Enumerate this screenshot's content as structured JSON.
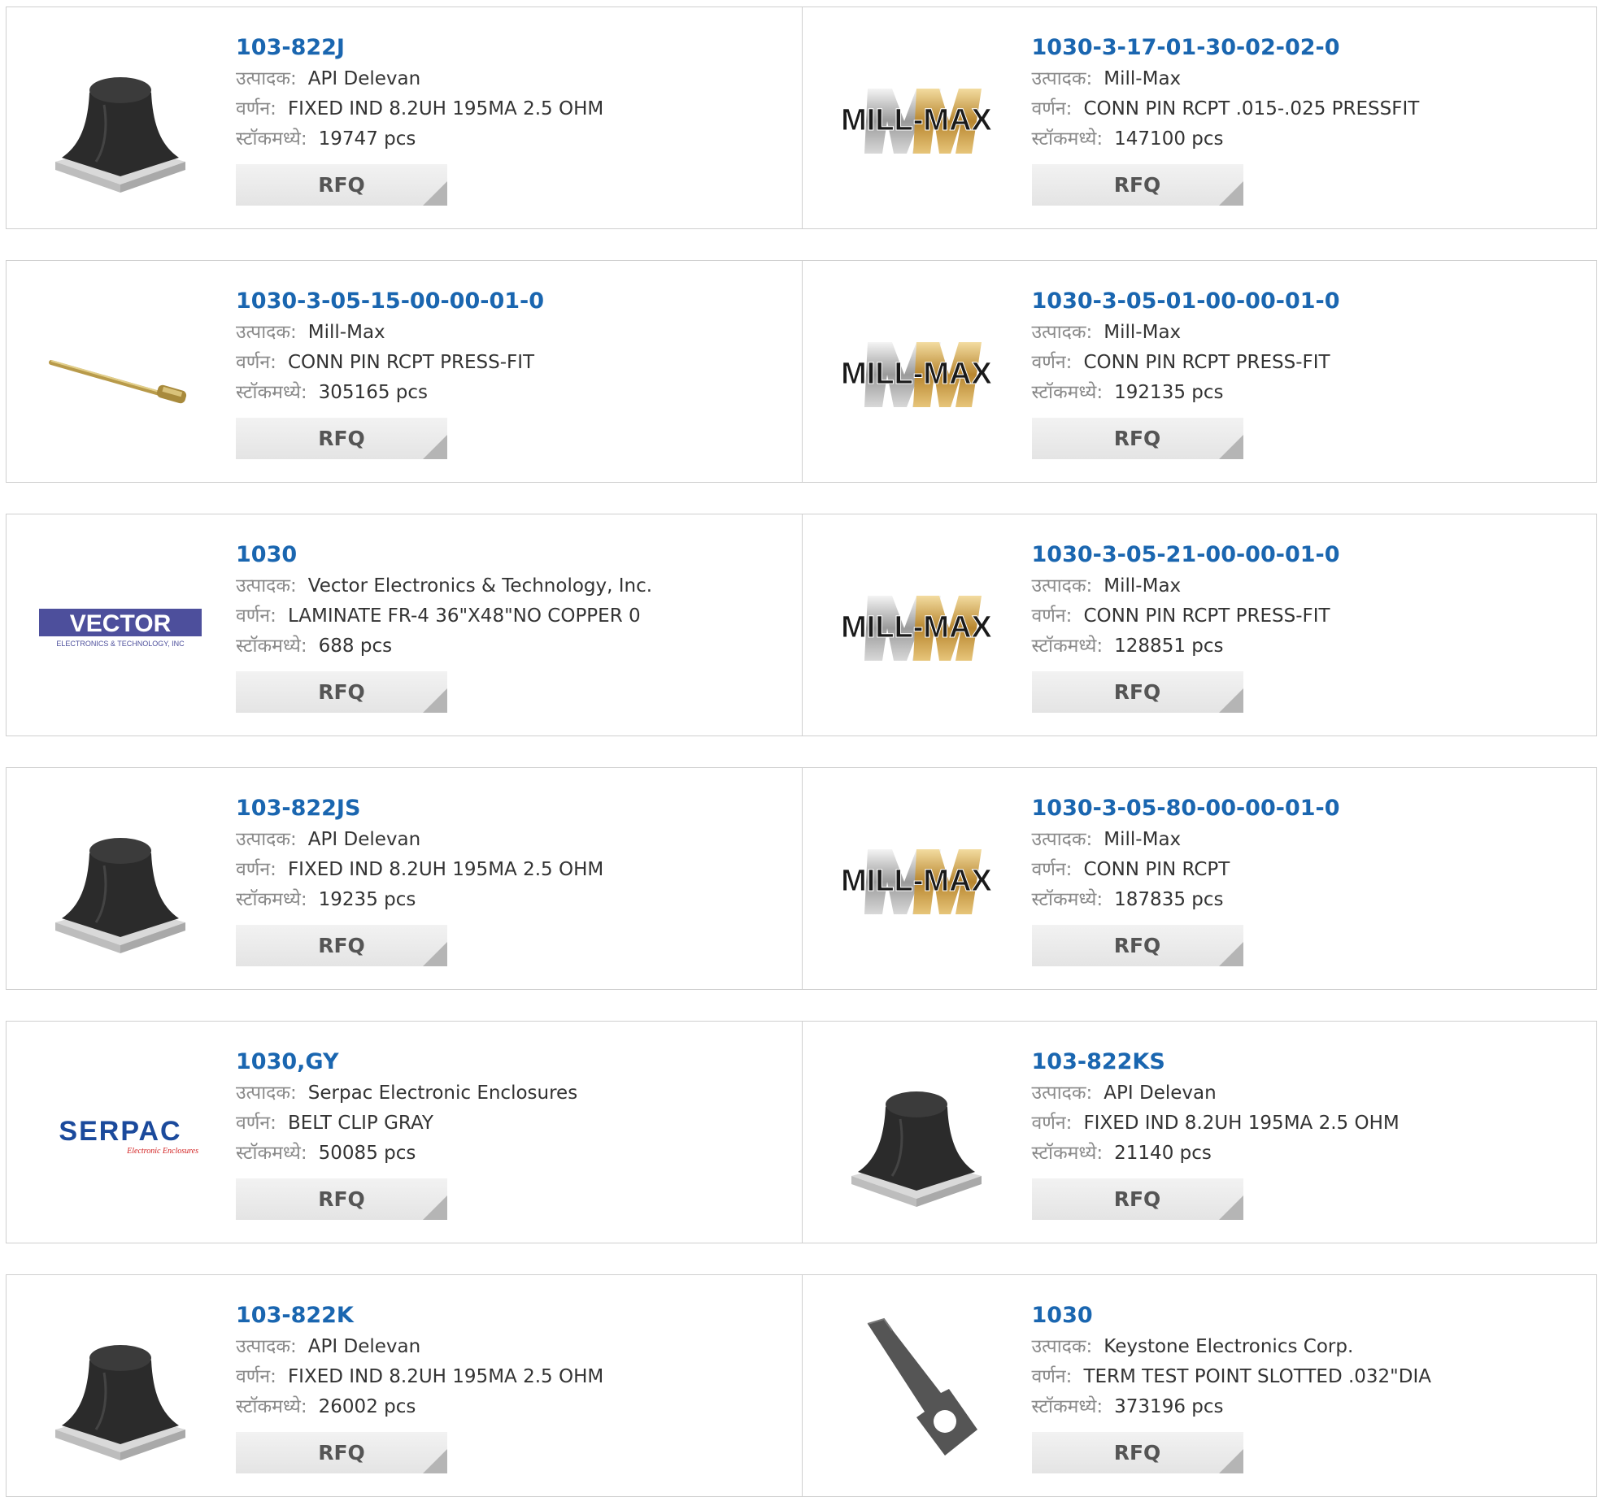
{
  "labels": {
    "manufacturer": "उत्पादक:",
    "description": "वर्णन:",
    "stock": "स्टॉकमध्ये:",
    "rfq": "RFQ"
  },
  "products": [
    {
      "part": "103-822J",
      "manufacturer": "API Delevan",
      "description": "FIXED IND 8.2UH 195MA 2.5 OHM",
      "stock": "19747 pcs",
      "image": "inductor-image"
    },
    {
      "part": "1030-3-17-01-30-02-02-0",
      "manufacturer": "Mill-Max",
      "description": "CONN PIN RCPT .015-.025 PRESSFIT",
      "stock": "147100 pcs",
      "image": "mill-max-logo"
    },
    {
      "part": "1030-3-05-15-00-00-01-0",
      "manufacturer": "Mill-Max",
      "description": "CONN PIN RCPT PRESS-FIT",
      "stock": "305165 pcs",
      "image": "pin-image"
    },
    {
      "part": "1030-3-05-01-00-00-01-0",
      "manufacturer": "Mill-Max",
      "description": "CONN PIN RCPT PRESS-FIT",
      "stock": "192135 pcs",
      "image": "mill-max-logo"
    },
    {
      "part": "1030",
      "manufacturer": "Vector Electronics & Technology, Inc.",
      "description": "LAMINATE FR-4 36\"X48\"NO COPPER 0",
      "stock": "688 pcs",
      "image": "vector-logo"
    },
    {
      "part": "1030-3-05-21-00-00-01-0",
      "manufacturer": "Mill-Max",
      "description": "CONN PIN RCPT PRESS-FIT",
      "stock": "128851 pcs",
      "image": "mill-max-logo"
    },
    {
      "part": "103-822JS",
      "manufacturer": "API Delevan",
      "description": "FIXED IND 8.2UH 195MA 2.5 OHM",
      "stock": "19235 pcs",
      "image": "inductor-image"
    },
    {
      "part": "1030-3-05-80-00-00-01-0",
      "manufacturer": "Mill-Max",
      "description": "CONN PIN RCPT",
      "stock": "187835 pcs",
      "image": "mill-max-logo"
    },
    {
      "part": "1030,GY",
      "manufacturer": "Serpac Electronic Enclosures",
      "description": "BELT CLIP GRAY",
      "stock": "50085 pcs",
      "image": "serpac-logo"
    },
    {
      "part": "103-822KS",
      "manufacturer": "API Delevan",
      "description": "FIXED IND 8.2UH 195MA 2.5 OHM",
      "stock": "21140 pcs",
      "image": "inductor-image"
    },
    {
      "part": "103-822K",
      "manufacturer": "API Delevan",
      "description": "FIXED IND 8.2UH 195MA 2.5 OHM",
      "stock": "26002 pcs",
      "image": "inductor-image"
    },
    {
      "part": "1030",
      "manufacturer": "Keystone Electronics Corp.",
      "description": "TERM TEST POINT SLOTTED .032\"DIA",
      "stock": "373196 pcs",
      "image": "test-point-image"
    }
  ],
  "logos": {
    "millmax": "MILL-MAX",
    "vector": "VECTOR",
    "vector_sub": "ELECTRONICS & TECHNOLOGY, INC",
    "serpac": "SERPAC",
    "serpac_sub": "Electronic Enclosures"
  },
  "colors": {
    "part_link": "#1a66b0",
    "border": "#cfcfcf",
    "button_bg": "#e9e9e9",
    "vector_blue": "#4d4f9c",
    "serpac_blue": "#1b4a9c",
    "serpac_red": "#d22020"
  }
}
